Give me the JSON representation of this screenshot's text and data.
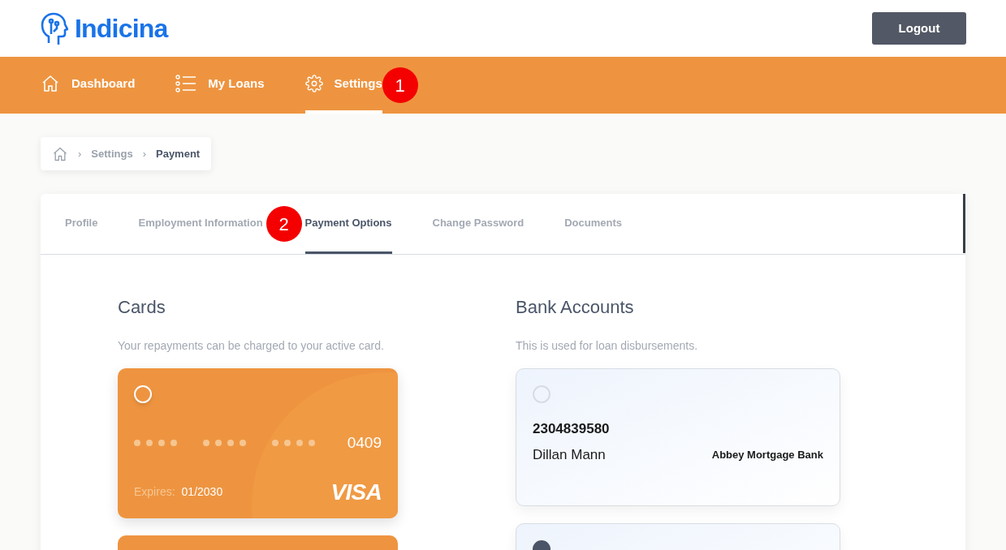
{
  "header": {
    "brand": "Indicina",
    "logout": "Logout"
  },
  "nav": [
    {
      "label": "Dashboard",
      "selected": false
    },
    {
      "label": "My Loans",
      "selected": false
    },
    {
      "label": "Settings",
      "selected": true
    }
  ],
  "breadcrumb": [
    {
      "separator": "›",
      "label": "Settings",
      "current": false
    },
    {
      "separator": "›",
      "label": "Payment",
      "current": true
    }
  ],
  "tabs": [
    {
      "label": "Profile",
      "selected": false
    },
    {
      "label": "Employment Information",
      "selected": false
    },
    {
      "label": "Payment Options",
      "selected": true
    },
    {
      "label": "Change Password",
      "selected": false
    },
    {
      "label": "Documents",
      "selected": false
    }
  ],
  "cards_section": {
    "title": "Cards",
    "description": "Your repayments can be charged to your active card.",
    "cards": [
      {
        "selected": false,
        "last4": "0409",
        "expires_label": "Expires:",
        "expires": "01/2030",
        "brand": "VISA"
      }
    ]
  },
  "bank_section": {
    "title": "Bank Accounts",
    "description": "This is used for loan disbursements.",
    "accounts": [
      {
        "selected": false,
        "number": "2304839580",
        "name": "Dillan Mann",
        "bank": "Abbey Mortgage Bank"
      },
      {
        "selected": true
      }
    ]
  },
  "annotations": [
    {
      "label": "1"
    },
    {
      "label": "2"
    }
  ]
}
